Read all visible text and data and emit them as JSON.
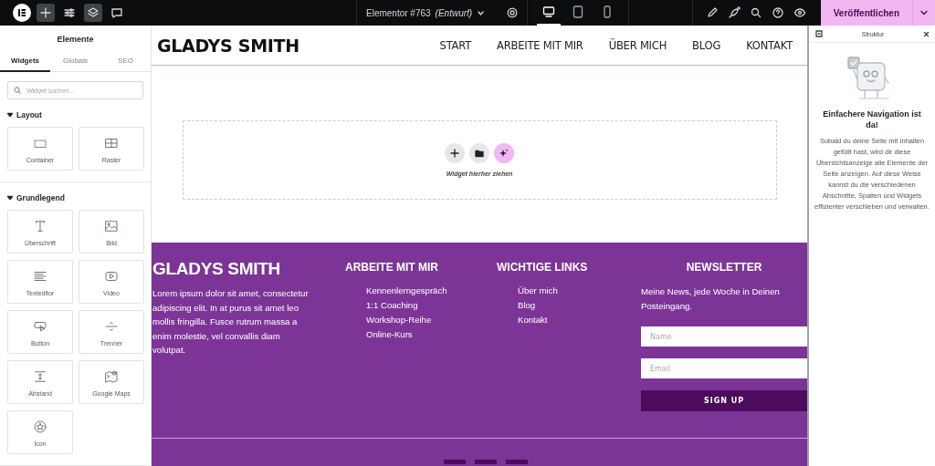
{
  "topbar": {
    "document_title": "Elementor #763",
    "document_status": "(Entwurf)",
    "device_modes": [
      {
        "kind": "desktop",
        "selected": true
      },
      {
        "kind": "tablet",
        "selected": false
      },
      {
        "kind": "mobile",
        "selected": false
      }
    ],
    "publish_button": "Veröffentlichen"
  },
  "widget_panel": {
    "title": "Elemente",
    "tabs": [
      {
        "label": "Widgets",
        "selected": true
      },
      {
        "label": "Globals",
        "selected": false
      },
      {
        "label": "SEO",
        "selected": false
      }
    ],
    "search": {
      "placeholder": "Widget suchen..."
    },
    "categories": [
      {
        "title": "Layout",
        "expanded": true,
        "widgets": [
          {
            "label": "Container",
            "kind": "container"
          },
          {
            "label": "Raster",
            "kind": "grid"
          }
        ]
      },
      {
        "title": "Grundlegend",
        "expanded": true,
        "widgets": [
          {
            "label": "Überschrift",
            "kind": "heading"
          },
          {
            "label": "Bild",
            "kind": "image"
          },
          {
            "label": "Texteditor",
            "kind": "text"
          },
          {
            "label": "Video",
            "kind": "video"
          },
          {
            "label": "Button",
            "kind": "button"
          },
          {
            "label": "Trenner",
            "kind": "divider"
          },
          {
            "label": "Abstand",
            "kind": "spacer"
          },
          {
            "label": "Google Maps",
            "kind": "map"
          },
          {
            "label": "Icon",
            "kind": "icon"
          }
        ]
      }
    ]
  },
  "page": {
    "header": {
      "site_title": "GLADYS SMITH",
      "nav": [
        "START",
        "ARBEITE MIT MIR",
        "ÜBER MICH",
        "BLOG",
        "KONTAKT"
      ]
    },
    "drop_zone": {
      "hint": "Widget hierher ziehen"
    },
    "footer": {
      "brand": "GLADYS SMITH",
      "about": "Lorem ipsum dolor sit amet, consectetur adipiscing elit. In at purus sit amet leo mollis fringilla. Fusce rutrum massa a enim molestie, vel convallis diam volutpat.",
      "link_columns": [
        {
          "title": "ARBEITE MIT MIR",
          "links": [
            "Kennenlerngespräch",
            "1:1 Coaching",
            "Workshop-Reihe",
            "Online-Kurs"
          ]
        },
        {
          "title": "WICHTIGE LINKS",
          "links": [
            "Über mich",
            "Blog",
            "Kontakt"
          ]
        }
      ],
      "newsletter": {
        "title": "NEWSLETTER",
        "text": "Meine News, jede Woche in Deinen Posteingang.",
        "fields": [
          {
            "placeholder": "Name"
          },
          {
            "placeholder": "Email"
          }
        ],
        "button": "SIGN UP"
      }
    }
  },
  "structure_panel": {
    "title": "Struktur",
    "heading": "Einfachere Navigation ist da!",
    "text": "Sobald du deine Seite mit Inhalten gefüllt hast, wird dir diese Übersichtsanzeige alle Elemente der Seite anzeigen. Auf diese Weise kannst du die verschiedenen Abschnitte, Spalten und Widgets effizienter verschieben und verwalten."
  }
}
